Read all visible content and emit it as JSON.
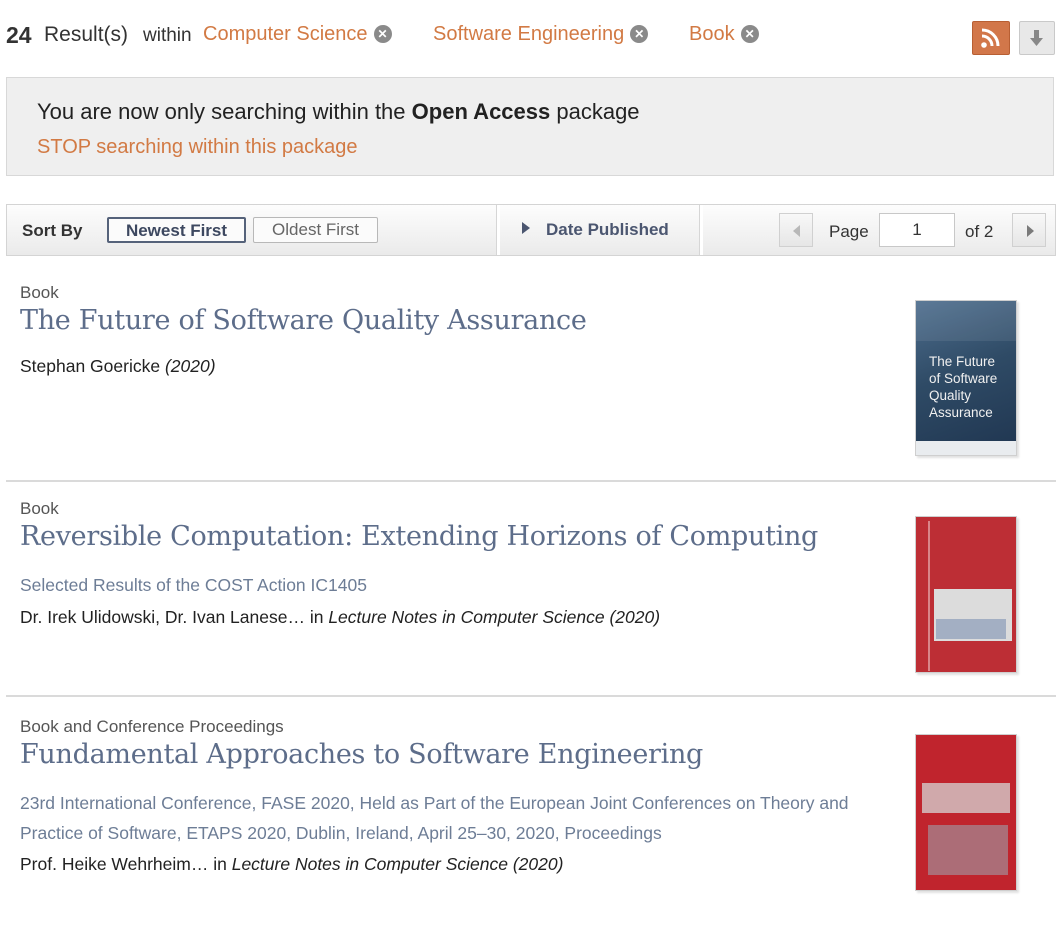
{
  "header": {
    "count": "24",
    "results_label": "Result(s)",
    "within": "within",
    "facets": [
      {
        "label": "Computer Science",
        "icon": "close-circle-icon"
      },
      {
        "label": "Software Engineering",
        "icon": "close-circle-icon"
      },
      {
        "label": "Book",
        "icon": "close-circle-icon"
      }
    ],
    "rss_icon": "rss-icon",
    "download_icon": "download-arrow-icon"
  },
  "banner": {
    "text_prefix": "You are now only searching within the ",
    "package_name": "Open Access",
    "text_suffix": " package",
    "stop_link": "STOP searching within this package"
  },
  "sortbar": {
    "sort_label": "Sort By",
    "newest": "Newest First",
    "oldest": "Oldest First",
    "date_published": "Date Published",
    "page_label": "Page",
    "page_value": "1",
    "page_of": "of 2"
  },
  "results": [
    {
      "type": "Book",
      "title": "The Future of Software Quality Assurance",
      "subtitle": "",
      "authors": "Stephan Goericke ",
      "series_prefix": "",
      "series": "(2020)",
      "cover_text": "The Future\nof Software\nQuality\nAssurance"
    },
    {
      "type": "Book",
      "title": "Reversible Computation: Extending Horizons of Computing",
      "subtitle": "Selected Results of the COST Action IC1405",
      "authors": "Dr. Irek Ulidowski, Dr. Ivan Lanese…",
      "series_prefix": " in ",
      "series": "Lecture Notes in Computer Science (2020)"
    },
    {
      "type": "Book and Conference Proceedings",
      "title": "Fundamental Approaches to Software Engineering",
      "subtitle": "23rd International Conference, FASE 2020, Held as Part of the European Joint Conferences on Theory and Practice of Software, ETAPS 2020, Dublin, Ireland, April 25–30, 2020, Proceedings",
      "authors": "Prof. Heike Wehrheim…",
      "series_prefix": " in ",
      "series": "Lecture Notes in Computer Science (2020)"
    }
  ],
  "colors": {
    "accent": "#d27a44",
    "title_link": "#5d6d8a",
    "subtitle": "#6d7d96"
  }
}
